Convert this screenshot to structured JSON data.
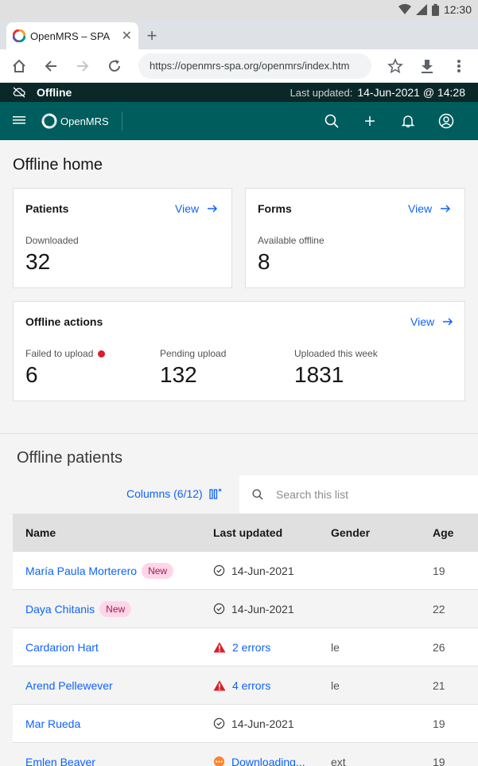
{
  "status_bar": {
    "time": "12:30"
  },
  "browser": {
    "tab_title": "OpenMRS – SPA",
    "tab_close": "✕",
    "new_tab": "+",
    "url": "https://openmrs-spa.org/openmrs/index.htm"
  },
  "offline_banner": {
    "label": "Offline",
    "last_updated_label": "Last updated:",
    "last_updated_value": "14-Jun-2021 @ 14:28"
  },
  "app_header": {
    "brand": "OpenMRS"
  },
  "page_title": "Offline home",
  "patients_card": {
    "title": "Patients",
    "link": "View",
    "stat_label": "Downloaded",
    "stat_value": "32"
  },
  "forms_card": {
    "title": "Forms",
    "link": "View",
    "stat_label": "Available offline",
    "stat_value": "8"
  },
  "actions_card": {
    "title": "Offline actions",
    "link": "View",
    "stats": [
      {
        "label": "Failed to upload",
        "value": "6"
      },
      {
        "label": "Pending upload",
        "value": "132"
      },
      {
        "label": "Uploaded this week",
        "value": "1831"
      }
    ]
  },
  "offline_patients": {
    "title": "Offline patients",
    "columns_button": "Columns (6/12)",
    "search_placeholder": "Search this list",
    "headers": {
      "name": "Name",
      "last_updated": "Last updated",
      "gender": "Gender",
      "age": "Age"
    },
    "rows": [
      {
        "name": "María Paula Morterero",
        "tag": "New",
        "status": "date",
        "updated": "14-Jun-2021",
        "gender": "",
        "age": "19"
      },
      {
        "name": "Daya Chitanis",
        "tag": "New",
        "status": "date",
        "updated": "14-Jun-2021",
        "gender": "",
        "age": "22"
      },
      {
        "name": "Cardarion Hart",
        "tag": "",
        "status": "error",
        "updated": "2 errors",
        "gender": "le",
        "age": "26"
      },
      {
        "name": "Arend Pellewever",
        "tag": "",
        "status": "error",
        "updated": "4 errors",
        "gender": "le",
        "age": "21"
      },
      {
        "name": "Mar Rueda",
        "tag": "",
        "status": "date",
        "updated": "14-Jun-2021",
        "gender": "",
        "age": "19"
      },
      {
        "name": "Emlen Beaver",
        "tag": "",
        "status": "downloading",
        "updated": "Downloading...",
        "gender": "ext",
        "age": "19"
      }
    ]
  },
  "colors": {
    "header": "#005d5d",
    "banner": "#0b2828",
    "link": "#0f62fe",
    "error": "#da1e28",
    "tag_bg": "#ffd6e8",
    "tag_fg": "#9f1853",
    "downloading": "#ff832b"
  }
}
